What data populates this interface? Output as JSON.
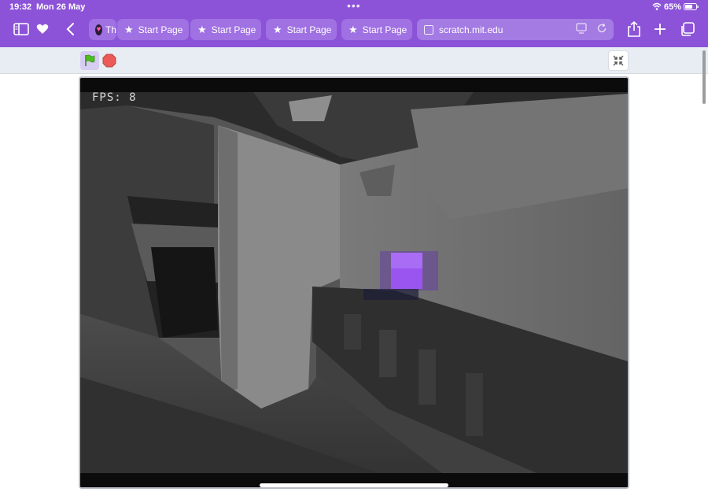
{
  "status_bar": {
    "time": "19:32",
    "date": "Mon 26 May",
    "battery": "65%"
  },
  "tabs": [
    {
      "label": "Th",
      "icon": "heart-favicon"
    },
    {
      "label": "Start Page",
      "icon": "star-icon"
    },
    {
      "label": "Start Page",
      "icon": "star-icon"
    },
    {
      "label": "Start Page",
      "icon": "star-icon"
    },
    {
      "label": "Start Page",
      "icon": "star-icon"
    }
  ],
  "url_bar": {
    "url": "scratch.mit.edu"
  },
  "stage": {
    "fps_label": "FPS: 8"
  },
  "colors": {
    "toolbar": "#8c53d8",
    "tab": "#a071e2",
    "scratch_bar": "#e8edf3",
    "cube": "#9a55f0"
  }
}
